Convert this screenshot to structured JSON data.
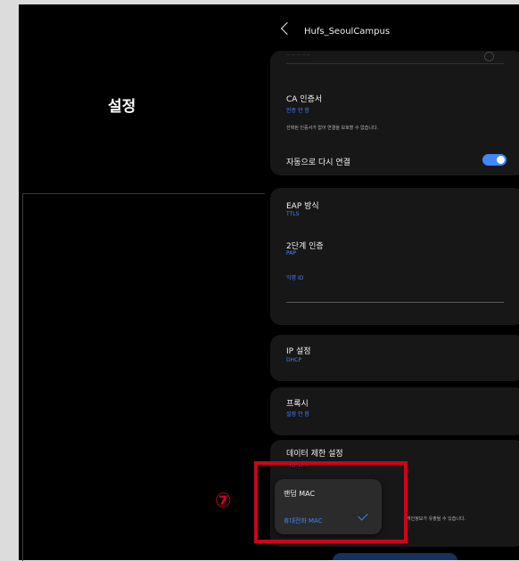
{
  "left": {
    "title": "설정"
  },
  "header": {
    "title": "Hufs_SeoulCampus"
  },
  "faded_top": "·· ·· ·· ·· ··",
  "ca_cert": {
    "label": "CA 인증서",
    "value": "인증 안 함",
    "note": "선택된 인증서가 없어 연결을 보호할 수 없습니다."
  },
  "auto_reconnect": {
    "label": "자동으로 다시 연결",
    "on": true
  },
  "eap": {
    "label": "EAP 방식",
    "value": "TTLS"
  },
  "phase2": {
    "label": "2단계 인증",
    "value": "PAP"
  },
  "anon_id": {
    "label": "익명 ID"
  },
  "ip": {
    "label": "IP 설정",
    "value": "DHCP"
  },
  "proxy": {
    "label": "프록시",
    "value": "설정 안 함"
  },
  "metered": {
    "label": "데이터 제한 설정",
    "value": "자동 감지"
  },
  "random_mac": {
    "note_tail": "개인정보가 유출될 수 있습니다."
  },
  "popup": {
    "title": "랜덤 MAC",
    "option": "휴대전화 MAC"
  },
  "annotation": {
    "marker": "⑦"
  },
  "colors": {
    "accent": "#3f86ff",
    "highlight": "#d0021b"
  }
}
